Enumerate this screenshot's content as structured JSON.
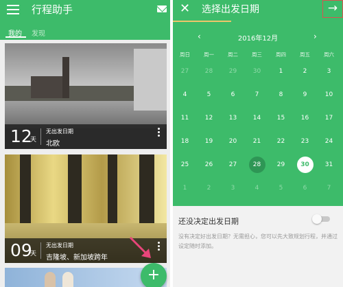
{
  "left": {
    "app_title": "行程助手",
    "tabs": [
      {
        "label": "我的",
        "active": true
      },
      {
        "label": "发现",
        "active": false
      }
    ],
    "trips": [
      {
        "days": "12",
        "unit": "天",
        "date_status": "无出发日期",
        "destination": "北欧"
      },
      {
        "days": "09",
        "unit": "天",
        "date_status": "无出发日期",
        "destination": "吉隆坡、新加坡跨年"
      }
    ],
    "fab_label": "+",
    "icons": {
      "menu": "menu-icon",
      "mail": "mail-icon",
      "more": "more-vert-icon",
      "add": "add-icon"
    }
  },
  "right": {
    "close_label": "✕",
    "title": "选择出发日期",
    "next_label": "→",
    "calendar": {
      "prev_label": "‹",
      "next_label": "›",
      "month": "2016年12月",
      "weekdays": [
        "周日",
        "周一",
        "周二",
        "周三",
        "周四",
        "周五",
        "周六"
      ],
      "weeks": [
        [
          "27",
          "28",
          "29",
          "30",
          "1",
          "2",
          "3"
        ],
        [
          "4",
          "5",
          "6",
          "7",
          "8",
          "9",
          "10"
        ],
        [
          "11",
          "12",
          "13",
          "14",
          "15",
          "16",
          "17"
        ],
        [
          "18",
          "19",
          "20",
          "21",
          "22",
          "23",
          "24"
        ],
        [
          "25",
          "26",
          "27",
          "28",
          "29",
          "30",
          "31"
        ],
        [
          "1",
          "2",
          "3",
          "4",
          "5",
          "6",
          "7"
        ]
      ],
      "today": "28",
      "selected": "30"
    },
    "undecided_title": "还没决定出发日期",
    "undecided_desc": "没有决定好出发日期？无需担心，您可以先大致规划行程，并通过设定随时添加。",
    "toggle_on": false
  },
  "colors": {
    "accent": "#3dbb6a",
    "highlight": "#d9534f",
    "today": "#2e9655",
    "annotation_arrow": "#e8457a"
  }
}
